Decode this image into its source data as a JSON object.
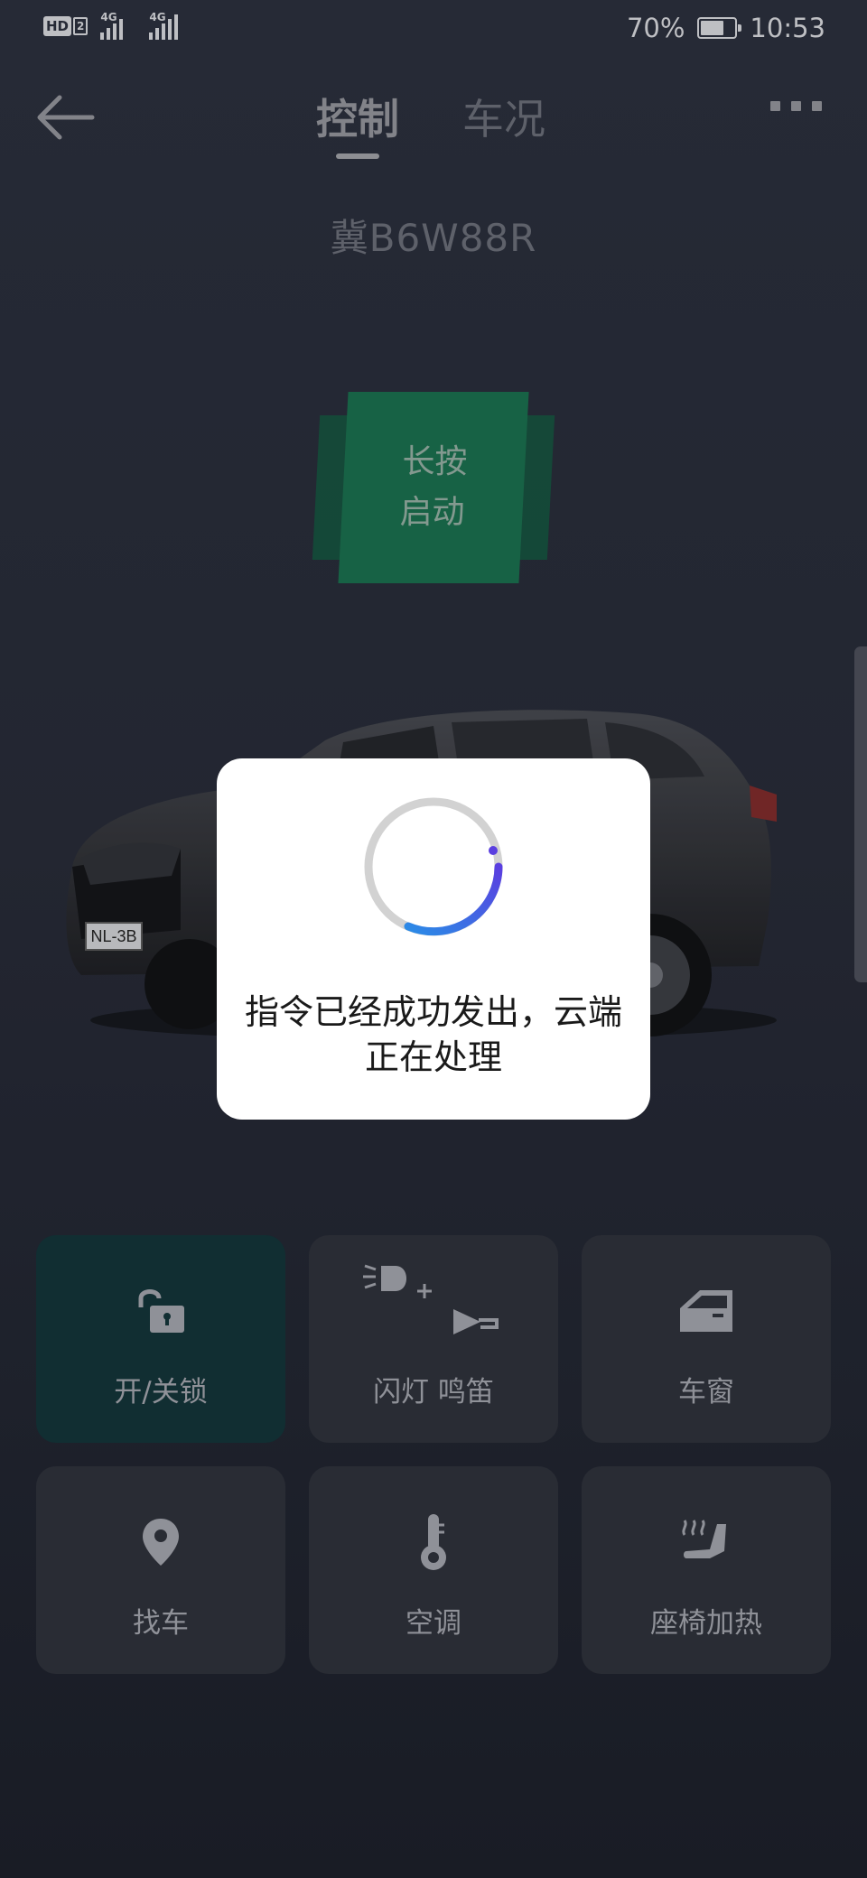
{
  "status_bar": {
    "hd_label": "HD",
    "hd_sim": "2",
    "net1": "4G",
    "net2": "4G",
    "battery_text": "70%",
    "battery_level": 0.7,
    "time": "10:53"
  },
  "header": {
    "back_icon": "arrow-left-icon",
    "tabs": [
      {
        "label": "控制",
        "active": true
      },
      {
        "label": "车况",
        "active": false
      }
    ],
    "more_icon": "more-dots-icon"
  },
  "vehicle": {
    "plate": "冀B6W88R",
    "start_button": {
      "line1": "长按",
      "line2": "启动"
    },
    "car_plate_text": "NL-3B"
  },
  "controls": [
    {
      "label": "开/关锁",
      "icon": "unlock-icon",
      "active": true
    },
    {
      "label": "闪灯 鸣笛",
      "icon": "flash-horn-icon",
      "active": false
    },
    {
      "label": "车窗",
      "icon": "car-window-icon",
      "active": false
    },
    {
      "label": "找车",
      "icon": "location-pin-icon",
      "active": false
    },
    {
      "label": "空调",
      "icon": "thermometer-icon",
      "active": false
    },
    {
      "label": "座椅加热",
      "icon": "seat-heat-icon",
      "active": false
    }
  ],
  "dialog": {
    "message": "指令已经成功发出，云端正在处理",
    "spinner_icon": "loading-spinner-icon"
  },
  "colors": {
    "accent_green": "#1a6b4b",
    "active_card": "#133237",
    "card": "#2d3039",
    "spinner_blue": "#2b8be6",
    "spinner_purple": "#5a3fe0"
  }
}
